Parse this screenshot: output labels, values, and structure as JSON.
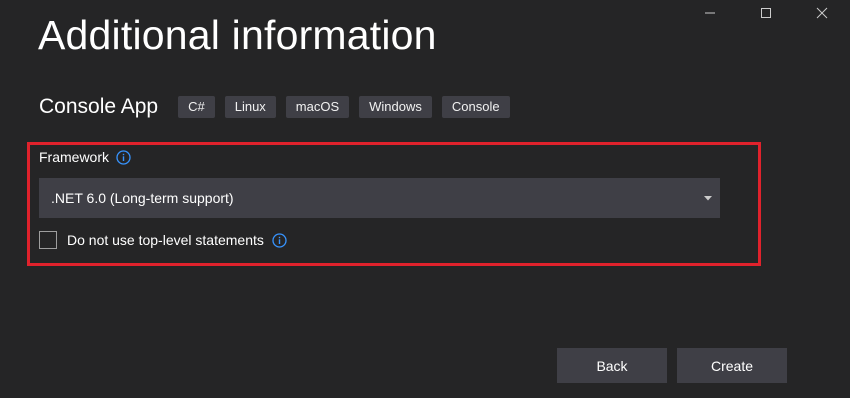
{
  "window_controls": {
    "minimize": "minimize-icon",
    "maximize": "maximize-icon",
    "close": "close-icon"
  },
  "header": {
    "title": "Additional information"
  },
  "project": {
    "name": "Console App",
    "tags": [
      "C#",
      "Linux",
      "macOS",
      "Windows",
      "Console"
    ]
  },
  "framework": {
    "label": "Framework",
    "selected": ".NET 6.0 (Long-term support)"
  },
  "options": {
    "top_level_statements_label": "Do not use top-level statements",
    "top_level_statements_checked": false
  },
  "footer": {
    "back_label": "Back",
    "create_label": "Create"
  },
  "colors": {
    "background": "#252526",
    "control": "#3f3f46",
    "highlight": "#e0222c",
    "info_icon": "#3794ff"
  }
}
